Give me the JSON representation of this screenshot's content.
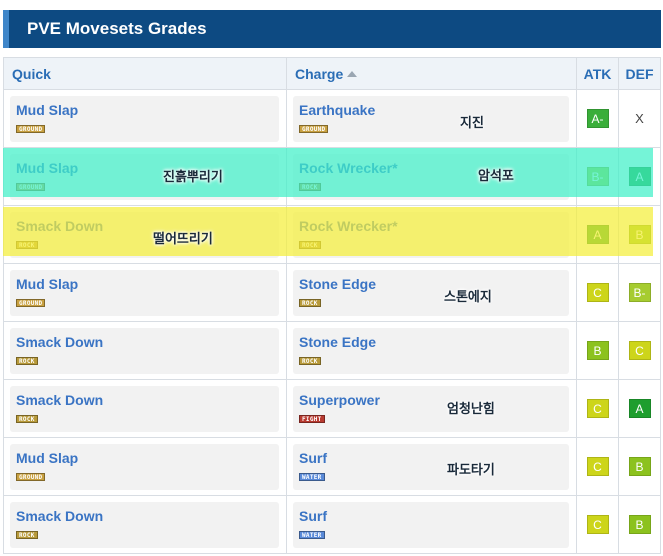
{
  "page": {
    "title": "PVE Movesets Grades"
  },
  "table": {
    "headers": {
      "quick": "Quick",
      "charge": "Charge",
      "atk": "ATK",
      "def": "DEF"
    },
    "rows": [
      {
        "quick": "Mud Slap",
        "quick_type": "GROUND",
        "charge": "Earthquake",
        "charge_type": "GROUND",
        "atk": "A-",
        "def": "X"
      },
      {
        "quick": "Mud Slap",
        "quick_type": "GROUND",
        "charge": "Rock Wrecker*",
        "charge_type": "ROCK",
        "atk": "B-",
        "def": "A"
      },
      {
        "quick": "Smack Down",
        "quick_type": "ROCK",
        "charge": "Rock Wrecker*",
        "charge_type": "ROCK",
        "atk": "A",
        "def": "B"
      },
      {
        "quick": "Mud Slap",
        "quick_type": "GROUND",
        "charge": "Stone Edge",
        "charge_type": "ROCK",
        "atk": "C",
        "def": "B-"
      },
      {
        "quick": "Smack Down",
        "quick_type": "ROCK",
        "charge": "Stone Edge",
        "charge_type": "ROCK",
        "atk": "B",
        "def": "C"
      },
      {
        "quick": "Smack Down",
        "quick_type": "ROCK",
        "charge": "Superpower",
        "charge_type": "FIGHT",
        "atk": "C",
        "def": "A"
      },
      {
        "quick": "Mud Slap",
        "quick_type": "GROUND",
        "charge": "Surf",
        "charge_type": "WATER",
        "atk": "C",
        "def": "B"
      },
      {
        "quick": "Smack Down",
        "quick_type": "ROCK",
        "charge": "Surf",
        "charge_type": "WATER",
        "atk": "C",
        "def": "B"
      }
    ]
  },
  "annotations": {
    "earthquake_ko": "지진",
    "mud_slap_ko": "진흙뿌리기",
    "rock_wrecker_ko": "암석포",
    "smack_down_ko": "떨어뜨리기",
    "stone_edge_ko": "스톤에지",
    "superpower_ko": "엄청난힘",
    "surf_ko": "파도타기"
  },
  "highlights": {
    "row2_color": "#40f0c8",
    "row3_color": "#f4ee3a"
  },
  "colors": {
    "types": {
      "GROUND": "#c8a040",
      "ROCK": "#b89a3a",
      "FIGHT": "#b83a30",
      "WATER": "#5a8ad8"
    },
    "grades": {
      "A": "#1e9e2e",
      "A-": "#3aae3a",
      "B": "#8cc21e",
      "B-": "#a6cc30",
      "C": "#cdd51a"
    }
  }
}
